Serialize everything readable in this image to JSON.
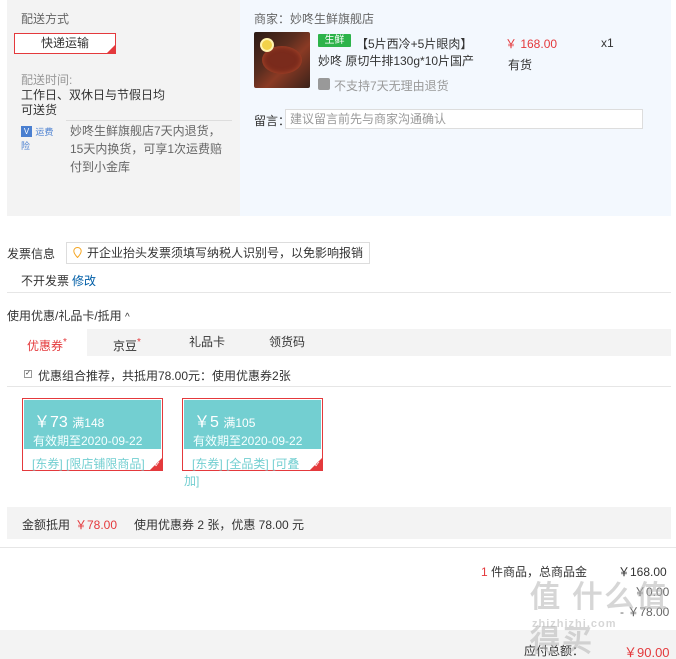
{
  "delivery": {
    "title": "配送方式",
    "method_button": "快递运输",
    "time_label": "配送时间:",
    "time_line1": "工作日、双休日与节假日均",
    "time_line2": "可送货",
    "insurance_label": "运费险",
    "insurance_line1": "妙咚生鲜旗舰店7天内退货，",
    "insurance_line2": "15天内换货，可享1次运费赔",
    "insurance_line3": "付到小金库"
  },
  "shop": {
    "merchant_prefix": "商家：",
    "merchant_name": "妙咚生鲜旗舰店",
    "fresh_badge": "生鲜",
    "product_line1": "【5片西冷+5片眼肉】",
    "product_line2": "妙咚 原切牛排130g*10片国产",
    "price": "￥ 168.00",
    "quantity": "x1",
    "stock": "有货",
    "return_policy": "不支持7天无理由退货",
    "remark_label": "留言：",
    "remark_placeholder": "建议留言前先与商家沟通确认"
  },
  "invoice": {
    "title": "发票信息",
    "tip": "开企业抬头发票须填写纳税人识别号，以免影响报销",
    "status": "不开发票",
    "edit_link": "修改"
  },
  "promo": {
    "title": "使用优惠/礼品卡/抵用",
    "tabs": [
      {
        "label": "优惠券",
        "star": "*"
      },
      {
        "label": "京豆",
        "star": "*"
      },
      {
        "label": "礼品卡",
        "star": ""
      },
      {
        "label": "领货码",
        "star": ""
      }
    ],
    "combo_text": "优惠组合推荐，共抵用78.00元：使用优惠券2张",
    "coupons": [
      {
        "amount": "￥73",
        "condition": "满148",
        "expiry": "有效期至2020-09-22",
        "tags": "[东券] [限店铺限商品]",
        "tags_more": ""
      },
      {
        "amount": "￥5",
        "condition": "满105",
        "expiry": "有效期至2020-09-22",
        "tags": "[东券] [全品类] [可叠",
        "tags_more": "加]"
      }
    ],
    "deduct_label": "金额抵用",
    "deduct_amount": "￥78.00",
    "deduct_summary": "使用优惠券 2 张，优惠 78.00 元"
  },
  "totals": {
    "count": "1",
    "count_text": "件商品，总商品金",
    "subtotal": "￥168.00",
    "row2_value": "￥0.00",
    "row3_value": "- ￥78.00",
    "payable_label": "应付总额：",
    "payable_value": "￥90.00"
  },
  "watermark": {
    "text": "值 什么值得买",
    "url": "zhizhizhi.com"
  },
  "colors": {
    "accent": "#e4393c",
    "coupon": "#73cfd1",
    "link": "#005ea7",
    "fresh": "#2db34a"
  }
}
